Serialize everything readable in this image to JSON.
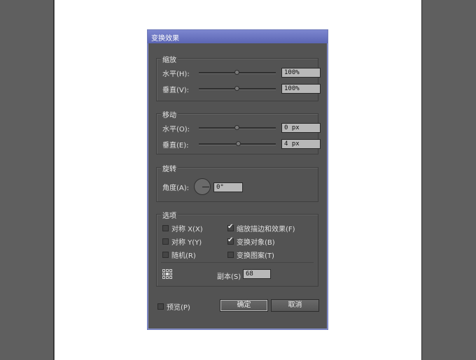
{
  "dialog": {
    "title": "变换效果",
    "scale": {
      "legend": "缩放",
      "horizontal_label": "水平(H):",
      "horizontal_value": "100%",
      "vertical_label": "垂直(V):",
      "vertical_value": "100%"
    },
    "move": {
      "legend": "移动",
      "horizontal_label": "水平(O):",
      "horizontal_value": "0 px",
      "vertical_label": "垂直(E):",
      "vertical_value": "4 px"
    },
    "rotate": {
      "legend": "旋转",
      "angle_label": "角度(A):",
      "angle_value": "0°"
    },
    "options": {
      "legend": "选项",
      "reflect_x": {
        "label": "对称 X(X)",
        "checked": false
      },
      "reflect_y": {
        "label": "对称 Y(Y)",
        "checked": false
      },
      "random": {
        "label": "随机(R)",
        "checked": false
      },
      "scale_strokes": {
        "label": "缩放描边和效果(F)",
        "checked": true
      },
      "transform_objects": {
        "label": "变换对象(B)",
        "checked": true
      },
      "transform_patterns": {
        "label": "变换图案(T)",
        "checked": false
      },
      "copies_label": "副本(S)",
      "copies_value": "68",
      "reference_point_icon": "reference-point-grid-icon"
    },
    "preview": {
      "label": "预览(P)",
      "checked": false
    },
    "ok_label": "确定",
    "cancel_label": "取消"
  },
  "colors": {
    "dialog_bg": "#535353",
    "titlebar": "#6f7ab8",
    "field_bg": "#b8b8b8"
  }
}
